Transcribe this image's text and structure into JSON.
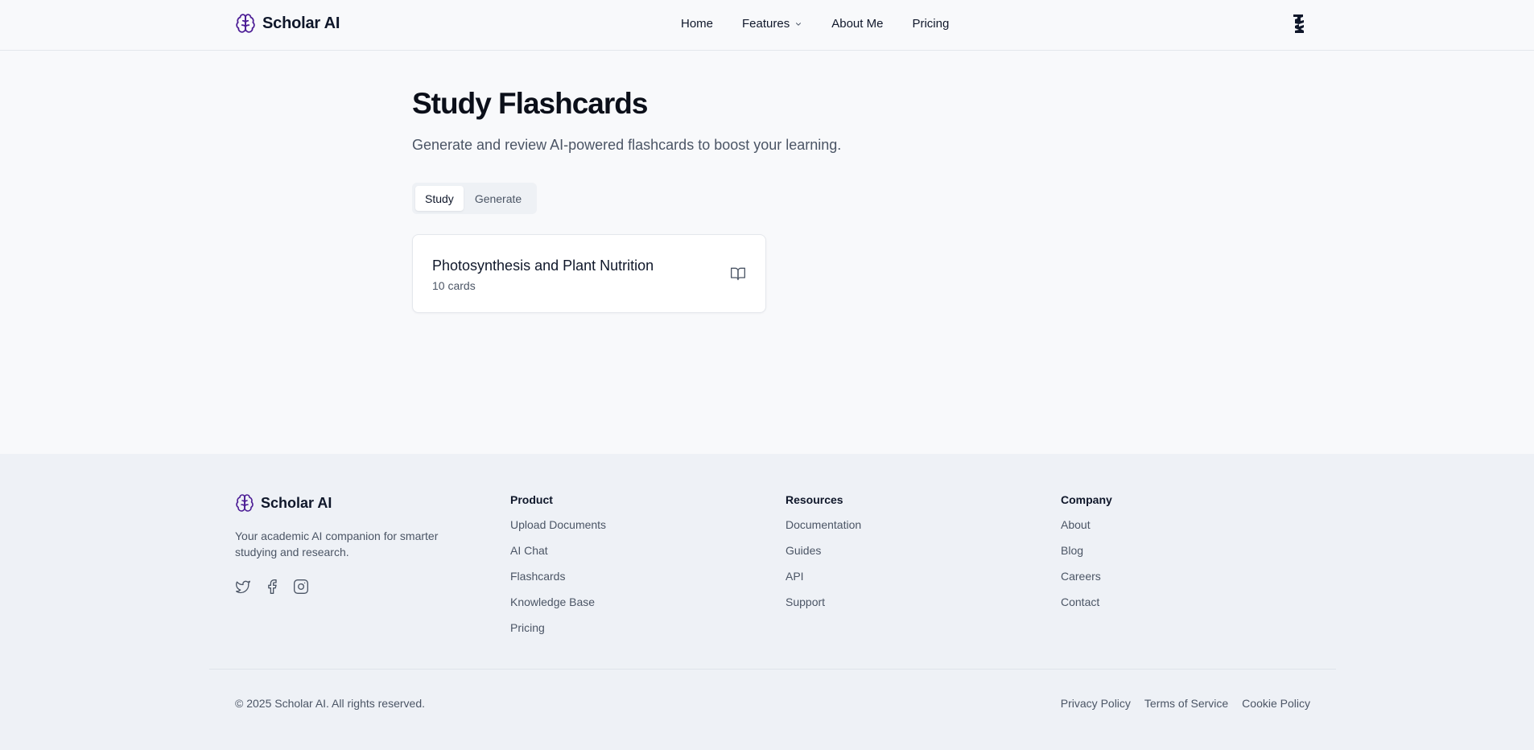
{
  "header": {
    "brand": "Scholar AI",
    "nav": {
      "home": "Home",
      "features": "Features",
      "about": "About Me",
      "pricing": "Pricing"
    }
  },
  "main": {
    "title": "Study Flashcards",
    "subtitle": "Generate and review AI-powered flashcards to boost your learning.",
    "tabs": [
      {
        "label": "Study",
        "active": true
      },
      {
        "label": "Generate",
        "active": false
      }
    ],
    "deck": {
      "title": "Photosynthesis and Plant Nutrition",
      "count": "10 cards"
    }
  },
  "footer": {
    "brand": "Scholar AI",
    "description": "Your academic AI companion for smarter studying and research.",
    "socials": [
      "twitter-icon",
      "facebook-icon",
      "instagram-icon"
    ],
    "product": {
      "heading": "Product",
      "links": [
        "Upload Documents",
        "AI Chat",
        "Flashcards",
        "Knowledge Base",
        "Pricing"
      ]
    },
    "resources": {
      "heading": "Resources",
      "links": [
        "Documentation",
        "Guides",
        "API",
        "Support"
      ]
    },
    "company": {
      "heading": "Company",
      "links": [
        "About",
        "Blog",
        "Careers",
        "Contact"
      ]
    },
    "copyright": "© 2025 Scholar AI. All rights reserved.",
    "legal": [
      "Privacy Policy",
      "Terms of Service",
      "Cookie Policy"
    ]
  },
  "colors": {
    "accent": "#4c1d95",
    "text": "#0f172a",
    "muted": "#4b5565",
    "background": "#f8f9fb",
    "footer_bg": "#eef1f6"
  }
}
